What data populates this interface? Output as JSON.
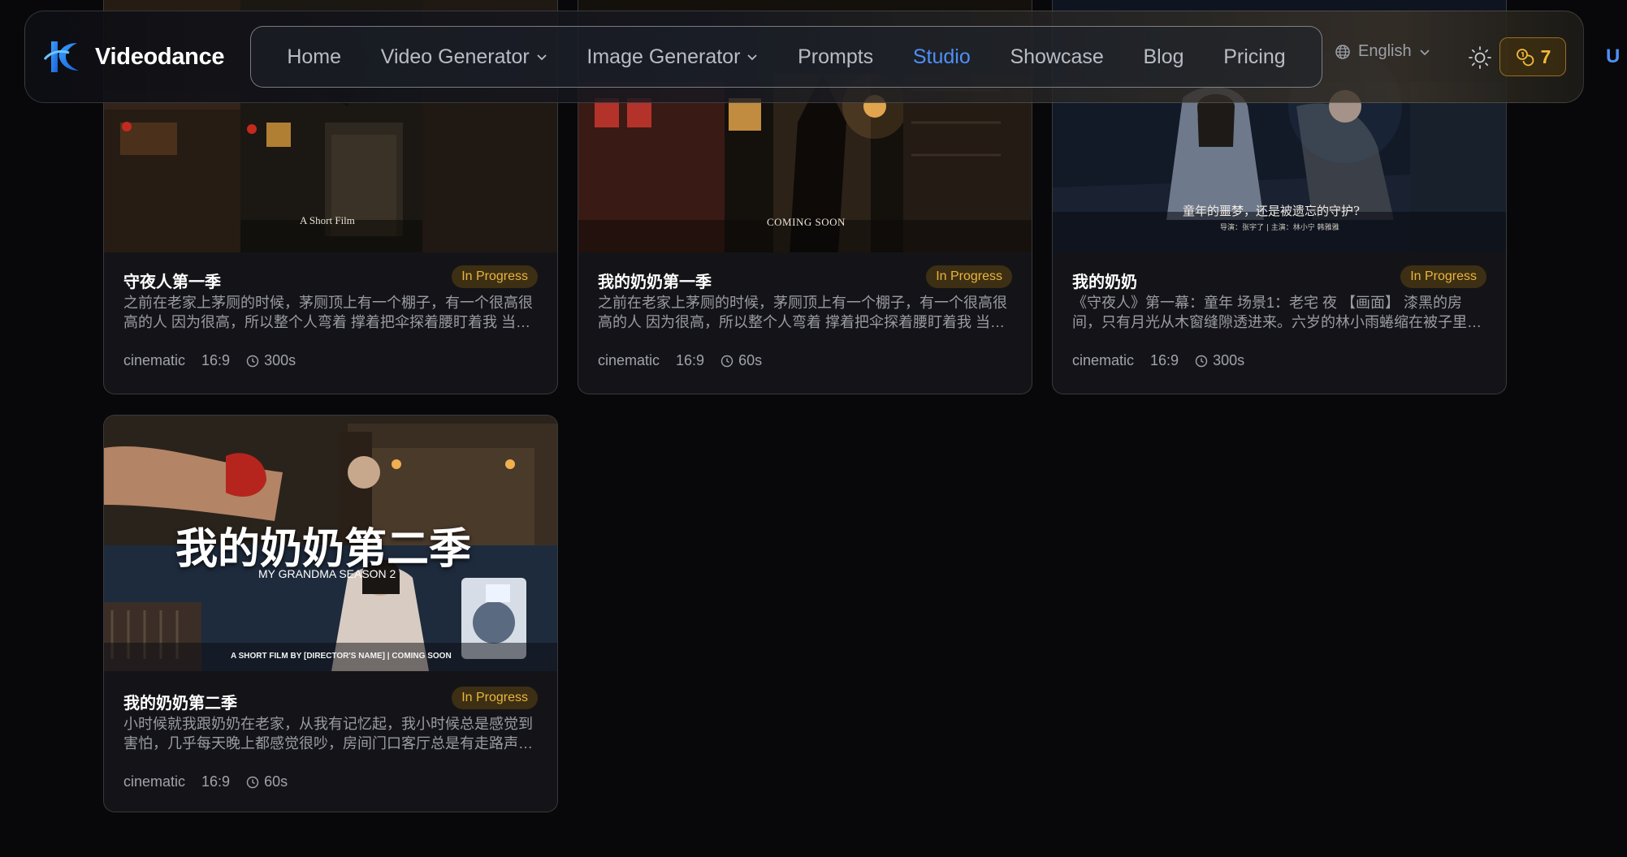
{
  "brand": {
    "name": "Videodance"
  },
  "nav": {
    "items": [
      {
        "label": "Home",
        "dropdown": false,
        "active": false
      },
      {
        "label": "Video Generator",
        "dropdown": true,
        "active": false
      },
      {
        "label": "Image Generator",
        "dropdown": true,
        "active": false
      },
      {
        "label": "Prompts",
        "dropdown": false,
        "active": false
      },
      {
        "label": "Studio",
        "dropdown": false,
        "active": true
      },
      {
        "label": "Showcase",
        "dropdown": false,
        "active": false
      },
      {
        "label": "Blog",
        "dropdown": false,
        "active": false
      },
      {
        "label": "Pricing",
        "dropdown": false,
        "active": false
      }
    ]
  },
  "header": {
    "language": "English",
    "credits": "7",
    "user_initial": "U"
  },
  "colors": {
    "accent": "#4f8ff7",
    "badge_text": "#eab53c",
    "credits": "#f1b93a"
  },
  "cards": [
    {
      "title": "守夜人第一季",
      "status": "In Progress",
      "description": "之前在老家上茅厕的时候，茅厕顶上有一个棚子，有一个很高很高的人 因为很高，所以整个人弯着 撑着把伞探着腰盯着我 当时我就吓了一跳",
      "style": "cinematic",
      "ratio": "16:9",
      "duration": "300s",
      "thumb_caption": "A Short Film"
    },
    {
      "title": "我的奶奶第一季",
      "status": "In Progress",
      "description": "之前在老家上茅厕的时候，茅厕顶上有一个棚子，有一个很高很高的人 因为很高，所以整个人弯着 撑着把伞探着腰盯着我 当时我就吓了一跳",
      "style": "cinematic",
      "ratio": "16:9",
      "duration": "60s",
      "thumb_caption": "COMING SOON"
    },
    {
      "title": "我的奶奶",
      "status": "In Progress",
      "description": "《守夜人》第一幕：童年 场景1：老宅 夜 【画面】 漆黑的房间，只有月光从木窗缝隙透进来。六岁的林小雨蜷缩在被子里瑟瑟发抖",
      "style": "cinematic",
      "ratio": "16:9",
      "duration": "300s",
      "thumb_caption": "童年的噩梦，还是被遗忘的守护?",
      "thumb_credit": "导演：张宇了 | 主演：林小宁 韩雅雅"
    },
    {
      "title": "我的奶奶第二季",
      "status": "In Progress",
      "description": "小时候就我跟奶奶在老家，从我有记忆起，我小时候总是感觉到害怕，几乎每天晚上都感觉很吵，房间门口客厅总是有走路声和说话声",
      "style": "cinematic",
      "ratio": "16:9",
      "duration": "60s",
      "thumb_title": "我的奶奶第二季",
      "thumb_subtitle": "MY GRANDMA SEASON 2",
      "thumb_caption": "A SHORT FILM BY [DIRECTOR'S NAME] | COMING SOON"
    }
  ]
}
